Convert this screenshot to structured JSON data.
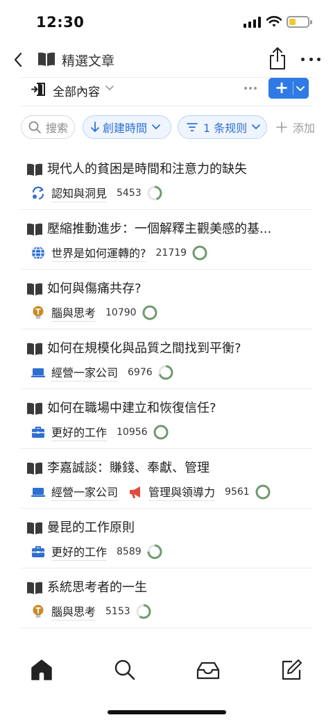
{
  "status_bar": {
    "time": "12:30",
    "battery_fraction": 0.3
  },
  "nav": {
    "title": "精選文章",
    "back_icon": "chevron-left-icon",
    "book_icon": "book-icon",
    "share_icon": "share-icon",
    "more_icon": "more-horizontal-icon"
  },
  "view": {
    "label": "全部內容",
    "add_label": "+"
  },
  "filters": {
    "search": "搜索",
    "sort": "創建時間",
    "rule": "1 条规则",
    "add": "添加"
  },
  "colors": {
    "accent": "#2f7ae5",
    "ring": "#6e9a6e",
    "ring_track": "#e5e5e5",
    "megaphone": "#e14b3b",
    "bulb": "#c98a25"
  },
  "articles": [
    {
      "title": "現代人的貧困是時間和注意力的缺失",
      "tags": [
        {
          "icon": "refresh-icon",
          "label": "認知與洞見"
        }
      ],
      "count": "5453",
      "progress": 0.45
    },
    {
      "title": "壓縮推動進步：一個解釋主觀美感的基...",
      "tags": [
        {
          "icon": "globe-icon",
          "label": "世界是如何運轉的?"
        }
      ],
      "count": "21719",
      "progress": 1.0
    },
    {
      "title": "如何與傷痛共存?",
      "tags": [
        {
          "icon": "lightbulb-icon",
          "label": "腦與思考"
        }
      ],
      "count": "10790",
      "progress": 1.0
    },
    {
      "title": "如何在規模化與品質之間找到平衡?",
      "tags": [
        {
          "icon": "laptop-icon",
          "label": "經營一家公司"
        }
      ],
      "count": "6976",
      "progress": 0.7
    },
    {
      "title": "如何在職場中建立和恢復信任?",
      "tags": [
        {
          "icon": "briefcase-icon",
          "label": "更好的工作"
        }
      ],
      "count": "10956",
      "progress": 1.0
    },
    {
      "title": "李嘉誠談：賺錢、奉獻、管理",
      "tags": [
        {
          "icon": "laptop-icon",
          "label": "經營一家公司"
        },
        {
          "icon": "megaphone-icon",
          "label": "管理與領導力"
        }
      ],
      "count": "9561",
      "progress": 1.0
    },
    {
      "title": "曼昆的工作原則",
      "tags": [
        {
          "icon": "briefcase-icon",
          "label": "更好的工作"
        }
      ],
      "count": "8589",
      "progress": 0.75
    },
    {
      "title": "系統思考者的一生",
      "tags": [
        {
          "icon": "lightbulb-icon",
          "label": "腦與思考"
        }
      ],
      "count": "5153",
      "progress": 0.6
    }
  ],
  "tabs": [
    "home-icon",
    "search-icon",
    "inbox-icon",
    "compose-icon"
  ]
}
